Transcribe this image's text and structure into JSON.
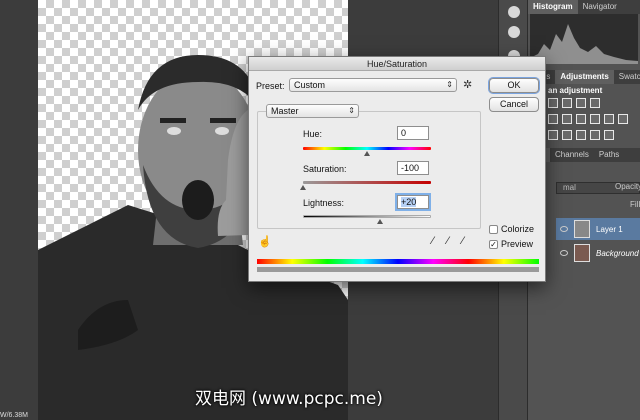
{
  "panels": {
    "histogram_tabs": [
      "Histogram",
      "Navigator"
    ],
    "adjust_tabs": [
      "aries",
      "Adjustments",
      "Swatch"
    ],
    "adjust_hint": "an adjustment",
    "layer_tabs": [
      "ers",
      "Channels",
      "Paths"
    ],
    "blend_mode": "mal",
    "opacity_label": "Opacity",
    "fill_label": "Fill",
    "layers": [
      {
        "name": "Layer 1",
        "selected": true
      },
      {
        "name": "Background",
        "selected": false
      }
    ]
  },
  "dialog": {
    "title": "Hue/Saturation",
    "preset_label": "Preset:",
    "preset_value": "Custom",
    "channel_value": "Master",
    "ok_label": "OK",
    "cancel_label": "Cancel",
    "hue_label": "Hue:",
    "hue_value": "0",
    "saturation_label": "Saturation:",
    "saturation_value": "-100",
    "lightness_label": "Lightness:",
    "lightness_value": "+20",
    "colorize_label": "Colorize",
    "colorize_checked": false,
    "preview_label": "Preview",
    "preview_checked": true,
    "check_mark": "✓"
  },
  "doc_info": "W/6.38M",
  "watermark": "双电网 (www.pcpc.me)",
  "colors": {
    "accent": "#5a7aa0",
    "panel_bg": "#535353",
    "dialog_bg": "#ececec"
  }
}
